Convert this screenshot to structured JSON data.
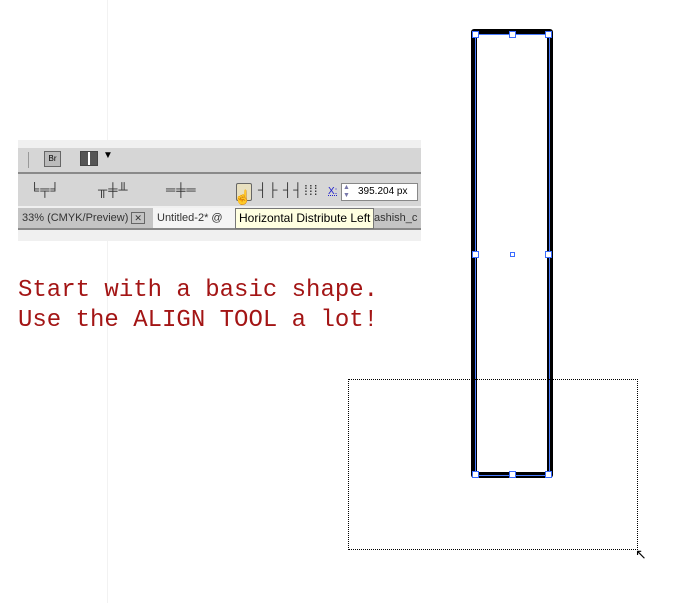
{
  "toolbar": {
    "bridge_label": "Br",
    "x_label": "X:",
    "x_value": "395.204 px",
    "align_icons": [
      "align-left-edges-icon",
      "align-horizontal-centers-icon",
      "align-right-edges-icon",
      "align-top-edges-icon",
      "align-vertical-centers-icon",
      "align-bottom-edges-icon",
      "distribute-top-icon",
      "distribute-vertical-centers-icon",
      "distribute-bottom-icon",
      "horizontal-distribute-left-icon",
      "horizontal-distribute-centers-icon",
      "horizontal-distribute-right-icon"
    ]
  },
  "tabs": [
    {
      "label": "33% (CMYK/Preview)"
    },
    {
      "label": "Untitled-2* @"
    },
    {
      "label": "ashish_c"
    }
  ],
  "tooltip": "Horizontal Distribute Left",
  "notes": [
    "Start with a basic shape.",
    "Use the ALIGN TOOL a lot!"
  ],
  "colors": {
    "note": "#a31515",
    "selection": "#4a7cff"
  }
}
